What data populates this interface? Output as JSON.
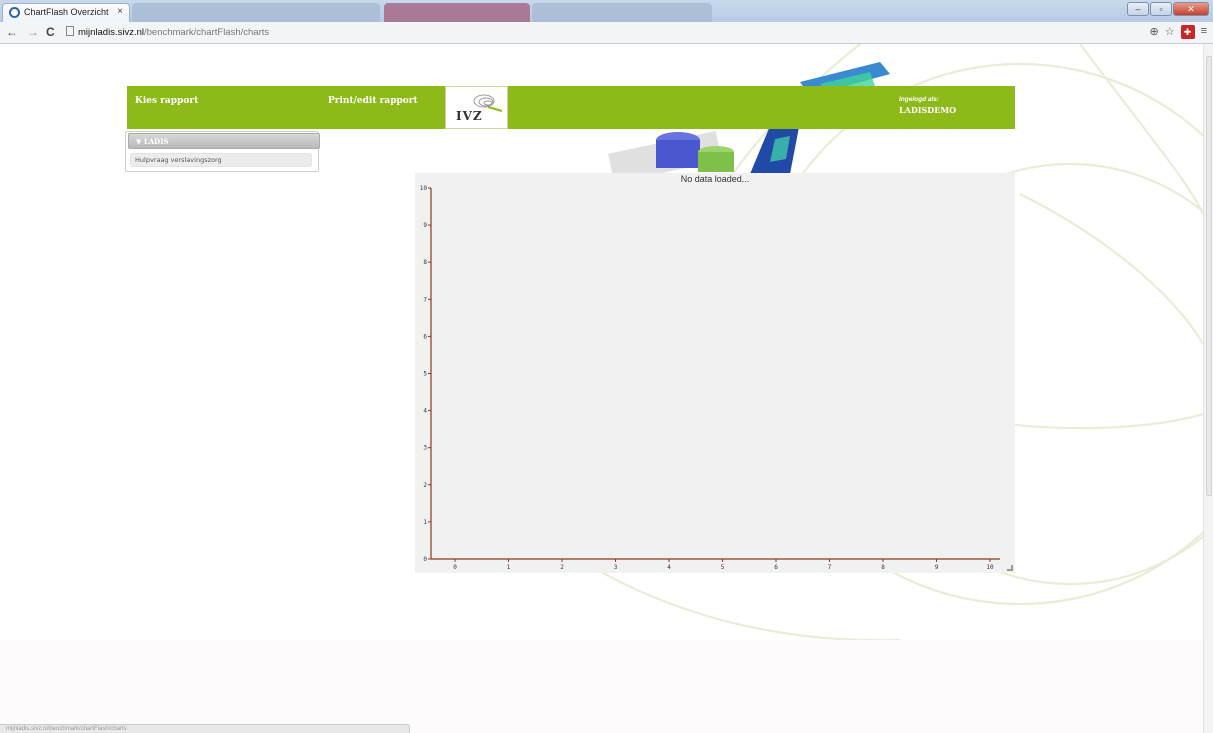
{
  "browser": {
    "tab_title": "ChartFlash Overzicht",
    "tab_close": "×",
    "url_host": "mijnladis.sivz.nl",
    "url_path": "/benchmark/chartFlash/charts",
    "status_url": "mijnladis.sivz.nl/benchmark/chartFlash/charts",
    "icons": [
      "back-icon",
      "forward-icon",
      "reload-icon",
      "page-icon",
      "zoom-icon",
      "star-icon",
      "extension-icon",
      "menu-icon"
    ]
  },
  "header": {
    "choose_report": "Kies rapport",
    "print_edit_report": "Print/edit rapport",
    "logo_text": "IVZ",
    "logged_in_label": "Ingelogd als:",
    "logged_in_user": "LADISDEMO"
  },
  "sidebar": {
    "group_label": "▼ LADIS",
    "items": [
      {
        "label": "Hulpvraag verslavingszorg"
      }
    ]
  },
  "chart": {
    "status_text": "No data loaded..."
  },
  "chart_data": {
    "type": "line",
    "title": "No data loaded...",
    "xlabel": "",
    "ylabel": "",
    "series": [],
    "xlim": [
      0,
      10
    ],
    "ylim": [
      0,
      10
    ],
    "x_ticks": [
      "0",
      "1",
      "2",
      "3",
      "4",
      "5",
      "6",
      "7",
      "8",
      "9",
      "10"
    ],
    "y_ticks": [
      "0",
      "1",
      "2",
      "3",
      "4",
      "5",
      "6",
      "7",
      "8",
      "9",
      "10"
    ],
    "grid": false,
    "axis_color": "#8b3a1a",
    "background": "#f1f1f1"
  },
  "colors": {
    "header_green": "#8dba19",
    "chart_bg": "#f1f1f1",
    "axis": "#8b3a1a"
  }
}
